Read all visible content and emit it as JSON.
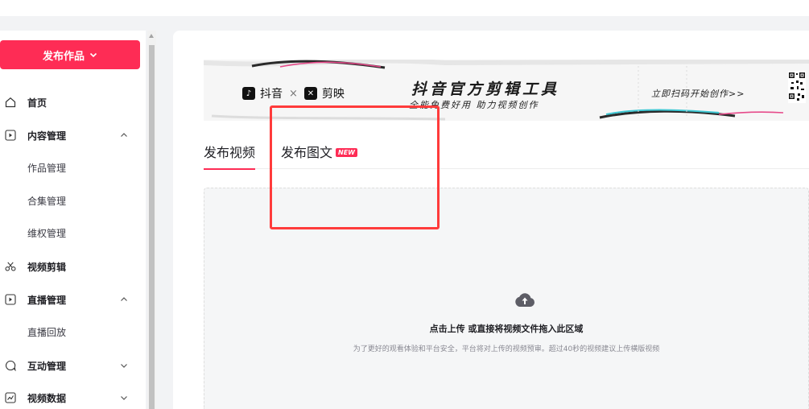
{
  "sidebar": {
    "publish_label": "发布作品",
    "items": [
      {
        "label": "首页",
        "icon": "home-icon"
      },
      {
        "label": "内容管理",
        "icon": "play-box-icon",
        "sub": [
          "作品管理",
          "合集管理",
          "维权管理"
        ]
      },
      {
        "label": "视频剪辑",
        "icon": "scissors-icon"
      },
      {
        "label": "直播管理",
        "icon": "play-box-icon",
        "sub": [
          "直播回放"
        ]
      },
      {
        "label": "互动管理",
        "icon": "chat-icon"
      },
      {
        "label": "视频数据",
        "icon": "chart-icon"
      }
    ]
  },
  "banner": {
    "brand_douyin": "抖音",
    "brand_times": "×",
    "brand_jianying": "剪映",
    "title": "抖音官方剪辑工具",
    "subtitle": "全能免费好用 助力视频创作",
    "cta": "立即扫码开始创作>>"
  },
  "tabs": {
    "video": "发布视频",
    "image_text": "发布图文",
    "new_badge": "NEW"
  },
  "upload": {
    "title": "点击上传 或直接将视频文件拖入此区域",
    "hint": "为了更好的观看体验和平台安全，平台将对上传的视频预审。超过40秒的视频建议上传横版视频"
  },
  "colors": {
    "accent": "#fe2c55",
    "highlight_box": "#ff3b3b"
  }
}
